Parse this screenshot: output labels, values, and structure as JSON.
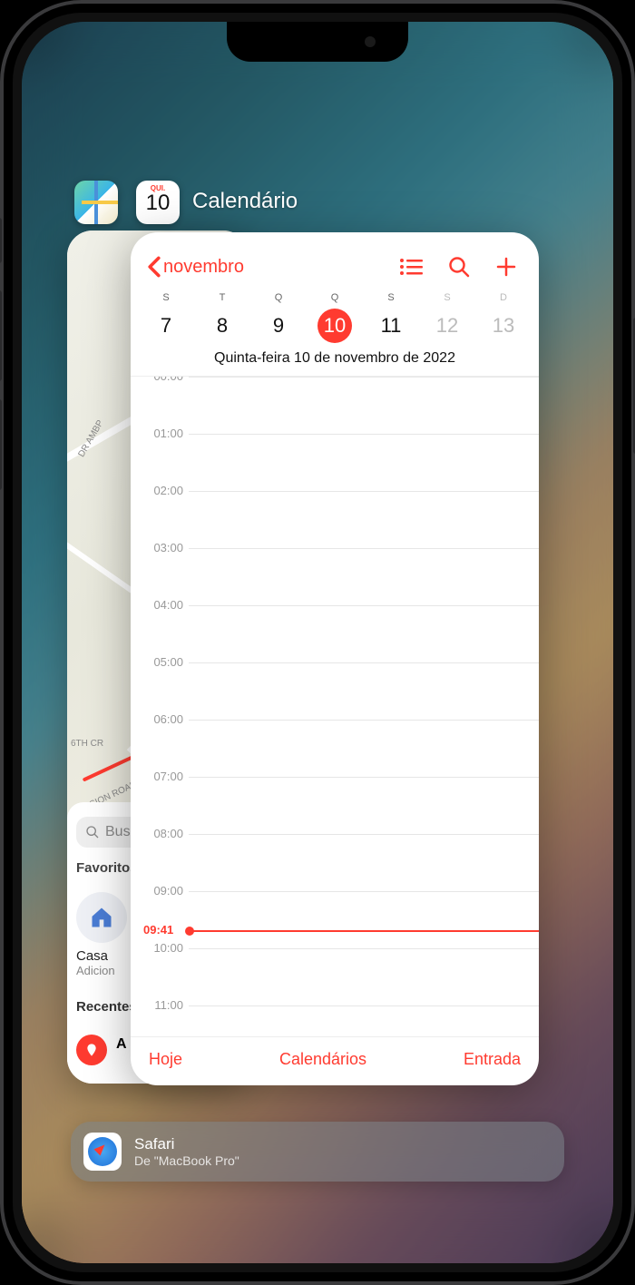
{
  "app_switcher": {
    "background_app_icon": "maps-icon",
    "foreground_app": {
      "icon_day_abbr": "QUI.",
      "icon_day_num": "10",
      "title": "Calendário"
    }
  },
  "maps": {
    "road_labels": [
      "DR AMBP",
      "6TH CR",
      "MISSION ROAD"
    ],
    "search_placeholder": "Bus",
    "favorites_label": "Favoritos",
    "home_label": "Casa",
    "home_sub": "Adicion",
    "recents_label": "Recentes",
    "recent_item_prefix": "A"
  },
  "calendar": {
    "accent": "#ff3b30",
    "back_label": "novembro",
    "week": {
      "day_abbrs": [
        "S",
        "T",
        "Q",
        "Q",
        "S",
        "S",
        "D"
      ],
      "day_nums": [
        "7",
        "8",
        "9",
        "10",
        "11",
        "12",
        "13"
      ],
      "today_index": 3,
      "weekend_indices": [
        5,
        6
      ]
    },
    "full_date": "Quinta-feira  10 de novembro de 2022",
    "hours": [
      "00:00",
      "01:00",
      "02:00",
      "03:00",
      "04:00",
      "05:00",
      "06:00",
      "07:00",
      "08:00",
      "09:00",
      "10:00",
      "11:00"
    ],
    "now_label": "09:41",
    "now_offset_fraction": 0.79,
    "footer": {
      "today": "Hoje",
      "calendars": "Calendários",
      "inbox": "Entrada"
    }
  },
  "handoff": {
    "app": "Safari",
    "from": "De \"MacBook Pro\""
  }
}
